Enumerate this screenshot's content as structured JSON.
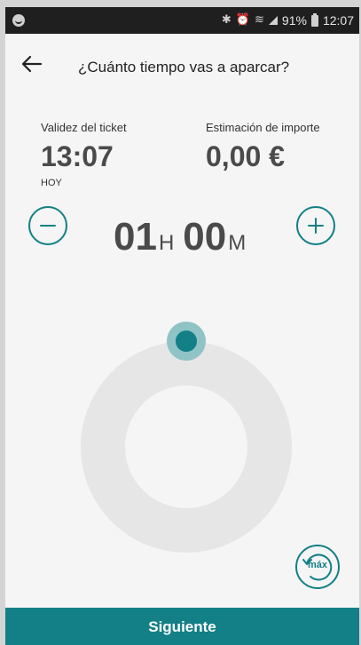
{
  "status_bar": {
    "battery_percent": "91%",
    "time": "12:07",
    "icons": [
      "notification-icon",
      "bluetooth-icon",
      "alarm-icon",
      "wifi-icon",
      "signal-icon",
      "battery-icon"
    ]
  },
  "header": {
    "back_icon": "arrow-left-icon",
    "title": "¿Cuánto tiempo vas a aparcar?"
  },
  "ticket": {
    "validity_label": "Validez del ticket",
    "validity_time": "13:07",
    "validity_day": "HOY",
    "estimate_label": "Estimación de importe",
    "estimate_amount": "0,00 €"
  },
  "duration": {
    "hours": "01",
    "hours_unit": "H",
    "minutes": "00",
    "minutes_unit": "M",
    "decrease_icon": "minus-icon",
    "increase_icon": "plus-icon"
  },
  "dial": {
    "max_label": "máx",
    "knob_position_fraction": 0
  },
  "colors": {
    "accent": "#137f86",
    "knob_halo": "#8fc3c6",
    "ring": "#e6e6e6",
    "background": "#f5f5f5"
  },
  "footer": {
    "next_label": "Siguiente"
  }
}
